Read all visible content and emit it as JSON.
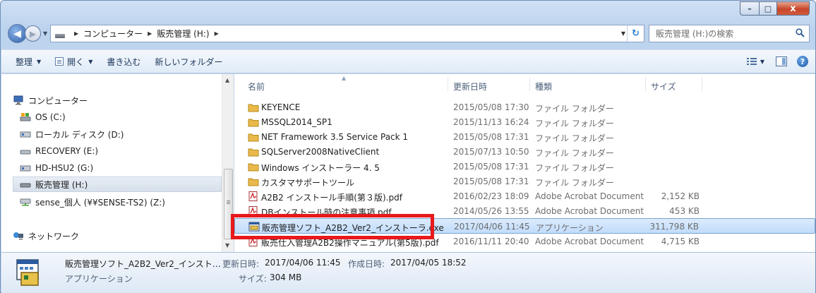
{
  "window": {
    "caption": {
      "minimize": "–",
      "maximize": "□",
      "close": "x"
    }
  },
  "address": {
    "back_icon": "arrow-left-icon",
    "breadcrumbs": [
      "コンピューター",
      "販売管理 (H:)"
    ],
    "search_placeholder": "販売管理 (H:)の検索"
  },
  "toolbar": {
    "organize": "整理",
    "open": "開く",
    "burn": "書き込む",
    "new_folder": "新しいフォルダー"
  },
  "nav_tree": [
    {
      "label": "コンピューター",
      "icon": "computer-icon"
    },
    {
      "label": "OS (C:)",
      "icon": "os-drive-icon"
    },
    {
      "label": "ローカル ディスク (D:)",
      "icon": "local-disk-icon"
    },
    {
      "label": "RECOVERY (E:)",
      "icon": "drive-icon"
    },
    {
      "label": "HD-HSU2 (G:)",
      "icon": "local-disk-icon"
    },
    {
      "label": "販売管理 (H:)",
      "icon": "drive-icon",
      "selected": true
    },
    {
      "label": "sense_個人 (¥¥SENSE-TS2) (Z:)",
      "icon": "network-drive-icon"
    },
    {
      "label": "ネットワーク",
      "icon": "network-icon"
    }
  ],
  "columns": {
    "name": "名前",
    "date": "更新日時",
    "type": "種類",
    "size": "サイズ"
  },
  "files": [
    {
      "name": "KEYENCE",
      "date": "2015/05/08 17:30",
      "type": "ファイル フォルダー",
      "size": "",
      "icon": "folder-icon"
    },
    {
      "name": "MSSQL2014_SP1",
      "date": "2015/11/13 16:24",
      "type": "ファイル フォルダー",
      "size": "",
      "icon": "folder-icon"
    },
    {
      "name": "NET Framework 3.5 Service Pack 1",
      "date": "2015/05/08 17:31",
      "type": "ファイル フォルダー",
      "size": "",
      "icon": "folder-icon"
    },
    {
      "name": "SQLServer2008NativeClient",
      "date": "2015/07/13 10:50",
      "type": "ファイル フォルダー",
      "size": "",
      "icon": "folder-icon"
    },
    {
      "name": "Windows インストーラー 4. 5",
      "date": "2015/05/08 17:31",
      "type": "ファイル フォルダー",
      "size": "",
      "icon": "folder-icon"
    },
    {
      "name": "カスタマサポートツール",
      "date": "2015/05/08 17:31",
      "type": "ファイル フォルダー",
      "size": "",
      "icon": "folder-icon"
    },
    {
      "name": "A2B2 インストール手順(第３版).pdf",
      "date": "2016/02/23 18:09",
      "type": "Adobe Acrobat Document",
      "size": "2,152 KB",
      "icon": "pdf-icon"
    },
    {
      "name": "DBインストール時の注意事項.pdf",
      "date": "2014/05/26 13:55",
      "type": "Adobe Acrobat Document",
      "size": "453 KB",
      "icon": "pdf-icon"
    },
    {
      "name": "販売管理ソフト_A2B2_Ver2_インストーラ.exe",
      "date": "2017/04/06 11:45",
      "type": "アプリケーション",
      "size": "311,798 KB",
      "icon": "installer-icon",
      "selected": true
    },
    {
      "name": "販売仕入管理A2B2操作マニュアル(第5版).pdf",
      "date": "2016/11/11 20:40",
      "type": "Adobe Acrobat Document",
      "size": "4,715 KB",
      "icon": "pdf-icon"
    }
  ],
  "details": {
    "name": "販売管理ソフト_A2B2_Ver2_インスト…",
    "type": "アプリケーション",
    "modified_label": "更新日時:",
    "modified": "2017/04/06 11:45",
    "created_label": "作成日時:",
    "created": "2017/04/05 18:52",
    "size_label": "サイズ:",
    "size": "304 MB"
  },
  "colors": {
    "highlight": "#e8191a",
    "selection": "#c1dcfc",
    "accent": "#1e395b"
  }
}
